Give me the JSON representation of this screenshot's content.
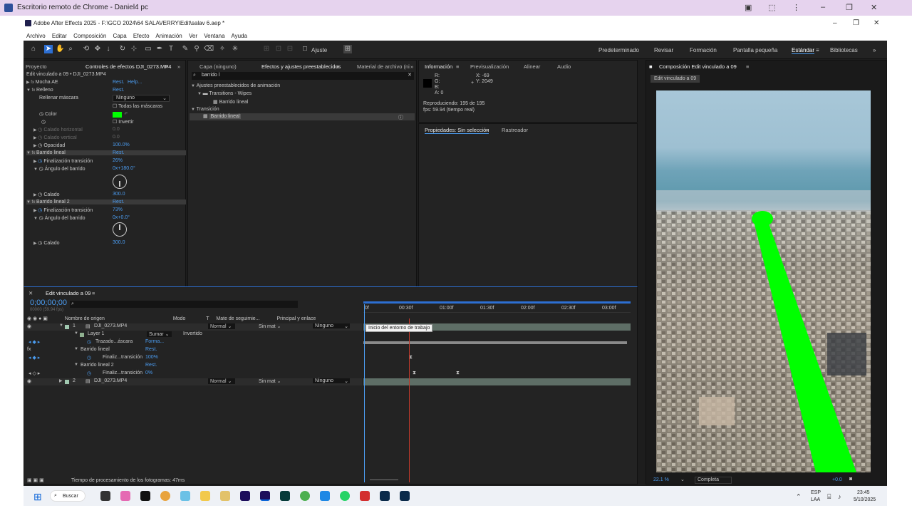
{
  "chrome": {
    "title": "Escritorio remoto de Chrome - Daniel4 pc"
  },
  "app": {
    "title": "Adobe After Effects 2025 - F:\\GCO 2024\\64 SALAVERRY\\Edit\\salav 6.aep *"
  },
  "menu": [
    "Archivo",
    "Editar",
    "Composición",
    "Capa",
    "Efecto",
    "Animación",
    "Ver",
    "Ventana",
    "Ayuda"
  ],
  "toolbar": {
    "ajuste": "Ajuste"
  },
  "workspaces": [
    "Predeterminado",
    "Revisar",
    "Formación",
    "Pantalla pequeña",
    "Estándar",
    "Bibliotecas"
  ],
  "effect_controls": {
    "tab_project": "Proyecto",
    "tab": "Controles de efectos DJI_0273.MP4",
    "header": "Edit vinculado a 09 • DJI_0273.MP4",
    "rows": [
      {
        "label": "Mocha AE",
        "val": "Rest.",
        "val2": "Help..."
      },
      {
        "label": "Relleno",
        "val": "Rest."
      },
      {
        "label": "Rellenar máscara",
        "val": "Ninguno"
      },
      {
        "label": "",
        "val": "Todas las máscaras"
      },
      {
        "label": "Color",
        "val": ""
      },
      {
        "label": "",
        "val": "Invertir"
      },
      {
        "label": "Calado horizontal",
        "val": "0.0"
      },
      {
        "label": "Calado vertical",
        "val": "0.0"
      },
      {
        "label": "Opacidad",
        "val": "100.0%"
      },
      {
        "label": "Barrido lineal",
        "val": "Rest."
      },
      {
        "label": "Finalización transición",
        "val": "26%"
      },
      {
        "label": "Ángulo del barrido",
        "val": "0x+180.0°"
      },
      {
        "label": "Calado",
        "val": "300.0"
      },
      {
        "label": "Barrido lineal 2",
        "val": "Rest."
      },
      {
        "label": "Finalización transición",
        "val": "73%"
      },
      {
        "label": "Ángulo del barrido",
        "val": "0x+0.0°"
      },
      {
        "label": "Calado",
        "val": "300.0"
      }
    ]
  },
  "effects_panel": {
    "tab_layer": "Capa (ninguno)",
    "tab": "Efectos y ajustes preestablecidos",
    "tab_material": "Material de archivo (ni",
    "search": "barrido l",
    "items": [
      "Ajustes preestablecidos de animación",
      "Transitions - Wipes",
      "Barrido lineal",
      "Transición",
      "Barrido lineal"
    ]
  },
  "info_panel": {
    "tabs": [
      "Información",
      "Previsualización",
      "Alinear",
      "Audio"
    ],
    "r": "R:",
    "g": "G:",
    "b": "B:",
    "a": "A: 0",
    "x": "X: -69",
    "y": "Y: 2049",
    "line1": "Reproduciendo: 195 de 195",
    "line2": "fps: 59.94 (tiempo real)"
  },
  "props_panel": {
    "tab": "Propiedades: Sin selección",
    "tab2": "Rastreador"
  },
  "composition": {
    "tab": "Composición Edit vinculado a 09",
    "sub": "Edit vinculado a 09",
    "zoom": "22.1 %",
    "res": "Completa",
    "exposure": "+0.0"
  },
  "timeline": {
    "tab": "Edit vinculado a 09",
    "timecode": "0;00;00;00",
    "fps": "00000 (59.94 fps)",
    "col_source": "Nombre de origen",
    "col_mode": "Modo",
    "col_t": "T",
    "col_matte": "Mate de seguimie...",
    "col_parent": "Principal y enlace",
    "ruler": [
      "0f",
      "00:30f",
      "01:00f",
      "01:30f",
      "02:00f",
      "02:30f",
      "03:00f"
    ],
    "tooltip": "Inicio del entorno de trabajo",
    "layers": [
      {
        "num": "1",
        "name": "DJI_0273.MP4",
        "mode": "Normal",
        "matte": "Sin mat",
        "parent": "Ninguno"
      },
      {
        "name": "Layer 1",
        "mode": "Sumar",
        "extra": "Invertido"
      },
      {
        "name": "Trazado...áscara",
        "val": "Forma..."
      },
      {
        "name": "Barrido lineal",
        "val": "Rest."
      },
      {
        "name": "Finaliz...transición",
        "val": "100%"
      },
      {
        "name": "Barrido lineal 2",
        "val": "Rest."
      },
      {
        "name": "Finaliz...transición",
        "val": "0%"
      },
      {
        "num": "2",
        "name": "DJI_0273.MP4",
        "mode": "Normal",
        "matte": "Sin mat",
        "parent": "Ninguno"
      }
    ],
    "footer": "Tiempo de procesamiento de los fotogramas: 47ms"
  },
  "taskbar": {
    "search": "Buscar",
    "lang": "ESP",
    "lang2": "LAA",
    "time": "23:45",
    "date": "5/10/2025"
  }
}
